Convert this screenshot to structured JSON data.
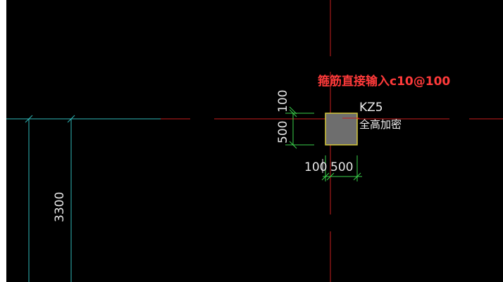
{
  "colors": {
    "background": "#000000",
    "left_margin": "#ffffff",
    "axis_red": "#c81e1e",
    "grid_cyan": "#2fb8b8",
    "dimension_green": "#3ad14a",
    "dimension_text": "#e6e6e6",
    "column_fill": "#6e6e6e",
    "column_border": "#d6c83a",
    "annotation_red": "#ff3a3a",
    "label_white": "#f0f0f0"
  },
  "annotation": {
    "text": "箍筋直接输入c10@100"
  },
  "column": {
    "name": "KZ5",
    "note": "全高加密",
    "width": "500",
    "height": "500"
  },
  "dimensions": {
    "vertical_offset": "100",
    "vertical_size": "500",
    "horizontal_offset": "100",
    "horizontal_size": "500",
    "grid_spacing": "3300"
  },
  "icons": {
    "axis_marker": "axis-bubble-icon"
  }
}
